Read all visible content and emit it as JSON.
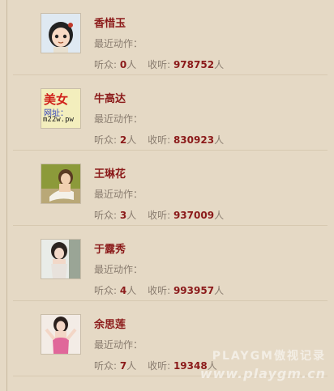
{
  "users": [
    {
      "name": "香惜玉",
      "recent_label": "最近动作：",
      "listeners_label": "听众:",
      "listeners": "0",
      "unit1": "人",
      "following_label": "收听:",
      "following": "978752",
      "unit2": "人",
      "avatar_icon": "cartoon-girl-avatar-icon"
    },
    {
      "name": "牛高达",
      "recent_label": "最近动作：",
      "listeners_label": "听众:",
      "listeners": "2",
      "unit1": "人",
      "following_label": "收听:",
      "following": "830923",
      "unit2": "人",
      "avatar_icon": "ad-banner-avatar-icon",
      "avatar_text": [
        "美女",
        "网址：",
        "m22w.pw"
      ]
    },
    {
      "name": "王琳花",
      "recent_label": "最近动作：",
      "listeners_label": "听众:",
      "listeners": "3",
      "unit1": "人",
      "following_label": "收听:",
      "following": "937009",
      "unit2": "人",
      "avatar_icon": "photo-avatar-icon"
    },
    {
      "name": "于露秀",
      "recent_label": "最近动作：",
      "listeners_label": "听众:",
      "listeners": "4",
      "unit1": "人",
      "following_label": "收听:",
      "following": "993957",
      "unit2": "人",
      "avatar_icon": "photo-avatar-icon"
    },
    {
      "name": "余思莲",
      "recent_label": "最近动作：",
      "listeners_label": "听众:",
      "listeners": "7",
      "unit1": "人",
      "following_label": "收听:",
      "following": "19348",
      "unit2": "人",
      "avatar_icon": "photo-avatar-icon"
    }
  ],
  "watermark": {
    "line1": "PLAYGM傲视记录",
    "line2": "www.playgm.cn"
  },
  "colors": {
    "background": "#e5d9c5",
    "name": "#8b1a1a",
    "muted": "#8a7d70"
  }
}
